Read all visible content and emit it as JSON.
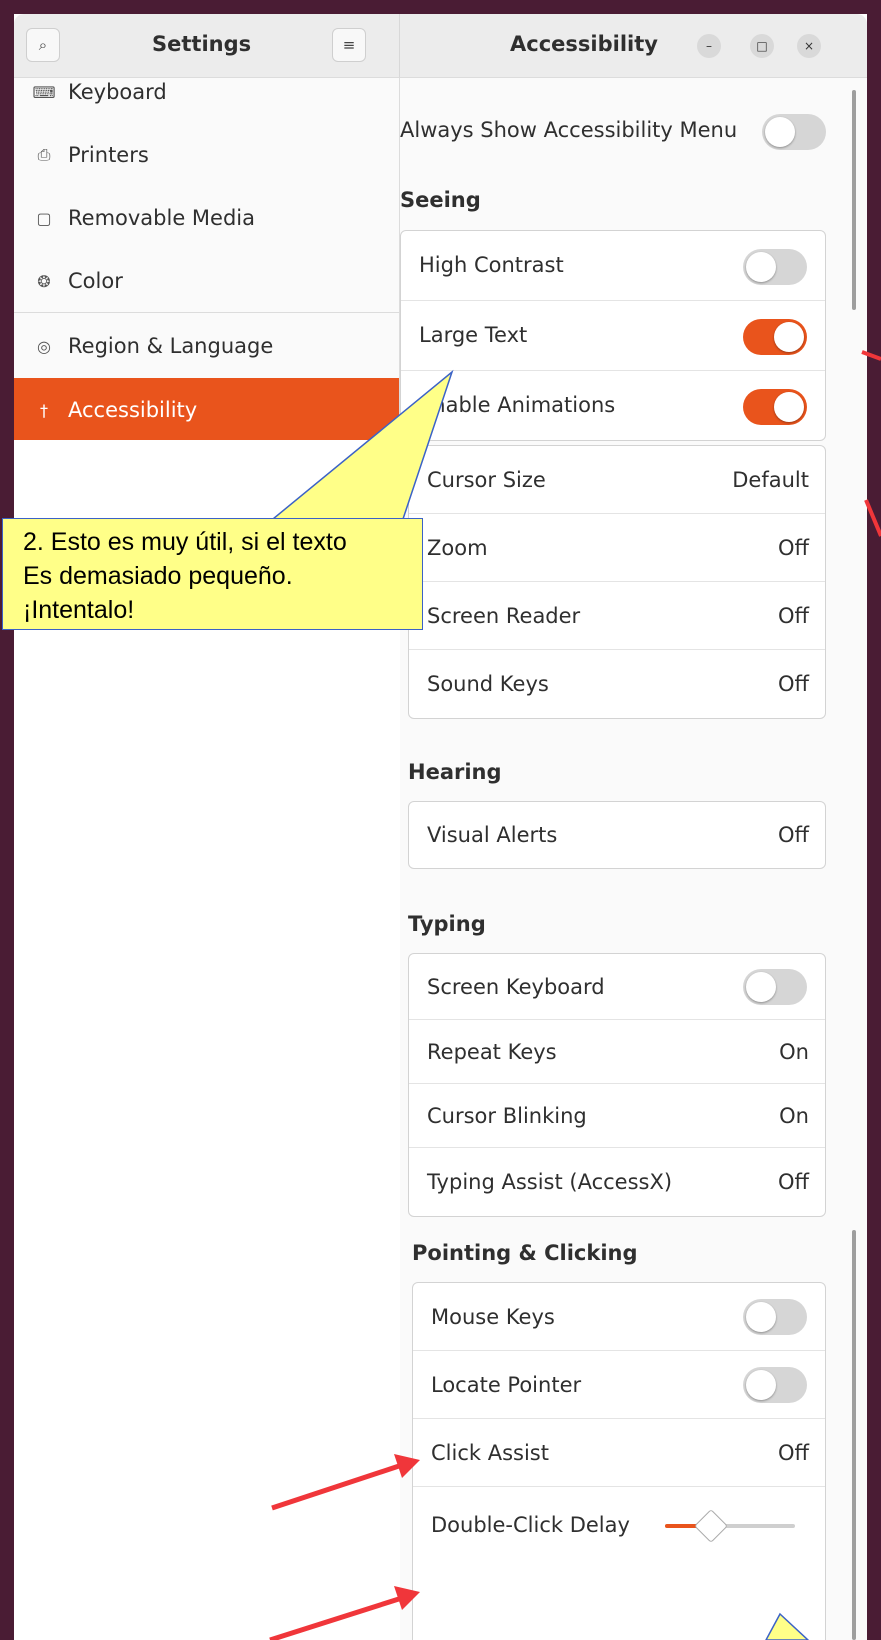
{
  "header": {
    "settings_title": "Settings",
    "page_title": "Accessibility",
    "search_glyph": "⌕",
    "menu_glyph": "≡",
    "minimize_glyph": "–",
    "maximize_glyph": "□",
    "close_glyph": "×"
  },
  "sidebar": {
    "items": [
      {
        "label": "Keyboard",
        "icon": "keyboard-icon",
        "glyph": "⌨"
      },
      {
        "label": "Printers",
        "icon": "printer-icon",
        "glyph": "⎙"
      },
      {
        "label": "Removable Media",
        "icon": "usb-icon",
        "glyph": "▢"
      },
      {
        "label": "Color",
        "icon": "color-icon",
        "glyph": "❂"
      },
      {
        "label": "Region & Language",
        "icon": "globe-icon",
        "glyph": "◎"
      },
      {
        "label": "Accessibility",
        "icon": "accessibility-icon",
        "glyph": "†",
        "active": true
      }
    ]
  },
  "content": {
    "always_show_label": "Always Show Accessibility Menu",
    "always_show_on": false,
    "seeing": {
      "heading": "Seeing",
      "toggles": [
        {
          "label": "High Contrast",
          "on": false
        },
        {
          "label": "Large Text",
          "on": true
        },
        {
          "label": "Enable Animations",
          "on": true
        }
      ],
      "values": [
        {
          "label": "Cursor Size",
          "value": "Default"
        },
        {
          "label": "Zoom",
          "value": "Off"
        },
        {
          "label": "Screen Reader",
          "value": "Off"
        },
        {
          "label": "Sound Keys",
          "value": "Off"
        }
      ]
    },
    "hearing": {
      "heading": "Hearing",
      "rows": [
        {
          "label": "Visual Alerts",
          "value": "Off"
        }
      ]
    },
    "typing": {
      "heading": "Typing",
      "screen_keyboard": {
        "label": "Screen Keyboard",
        "on": false
      },
      "rows": [
        {
          "label": "Repeat Keys",
          "value": "On"
        },
        {
          "label": "Cursor Blinking",
          "value": "On"
        },
        {
          "label": "Typing Assist (AccessX)",
          "value": "Off"
        }
      ]
    },
    "pointing": {
      "heading": "Pointing & Clicking",
      "mouse_keys": {
        "label": "Mouse Keys",
        "on": false
      },
      "locate_pointer": {
        "label": "Locate Pointer",
        "on": false
      },
      "click_assist": {
        "label": "Click Assist",
        "value": "Off"
      },
      "double_click": {
        "label": "Double-Click Delay",
        "level_fraction": 0.35
      }
    }
  },
  "callout": {
    "lines": [
      "2. Esto es muy útil, si el texto",
      "Es demasiado pequeño.",
      "¡Intentalo!"
    ]
  },
  "colors": {
    "accent": "#e9541c",
    "callout_fill": "#ffff88",
    "callout_border": "#3b62c7",
    "arrow_red": "#f0363a"
  }
}
